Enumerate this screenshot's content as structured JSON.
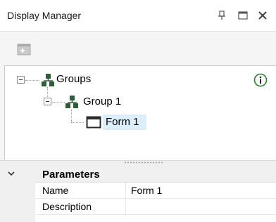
{
  "window": {
    "title": "Display Manager"
  },
  "tree": {
    "root_label": "Groups",
    "group_label": "Group 1",
    "form_label": "Form 1"
  },
  "properties": {
    "section_title": "Parameters",
    "rows": [
      {
        "name": "Name",
        "value": "Form 1"
      },
      {
        "name": "Description",
        "value": ""
      }
    ]
  },
  "icons": {
    "pin": "pin-icon",
    "maximize": "maximize-icon",
    "close": "close-icon",
    "add_form": "add-form-icon",
    "info": "info-icon",
    "group": "group-icon",
    "form": "form-window-icon",
    "collapse": "chevron-down-icon"
  },
  "colors": {
    "selection": "#dbeefc",
    "info_green": "#2e7d32",
    "group_icon": "#2f5d3a"
  }
}
